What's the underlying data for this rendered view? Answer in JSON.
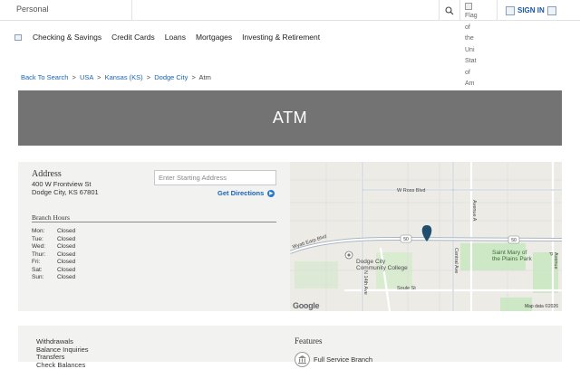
{
  "topbar": {
    "segment": "Personal",
    "flag_alt": "Flag of the United States of America",
    "flag_alt_visible": "Flag of the Uni Stat of Am",
    "signin_label": "SIGN IN"
  },
  "nav": {
    "items": [
      {
        "label": "Checking & Savings"
      },
      {
        "label": "Credit Cards"
      },
      {
        "label": "Loans"
      },
      {
        "label": "Mortgages"
      },
      {
        "label": "Investing & Retirement"
      }
    ]
  },
  "breadcrumb": {
    "back": "Back To Search",
    "country": "USA",
    "state": "Kansas (KS)",
    "city": "Dodge City",
    "current": "Atm",
    "separator": ">"
  },
  "banner": {
    "title": "ATM"
  },
  "location": {
    "address_title": "Address",
    "street": "400 W Frontview St",
    "city_line": "Dodge City, KS 67801",
    "start_placeholder": "Enter Starting Address",
    "directions_label": "Get Directions",
    "hours_title": "Branch Hours",
    "hours": [
      {
        "day": "Mon:",
        "status": "Closed"
      },
      {
        "day": "Tue:",
        "status": "Closed"
      },
      {
        "day": "Wed:",
        "status": "Closed"
      },
      {
        "day": "Thur:",
        "status": "Closed"
      },
      {
        "day": "Fri:",
        "status": "Closed"
      },
      {
        "day": "Sat:",
        "status": "Closed"
      },
      {
        "day": "Sun:",
        "status": "Closed"
      }
    ]
  },
  "map": {
    "labels": {
      "ross": "W Ross Blvd",
      "college": "Dodge City\nCommunity College",
      "saint_mary": "Saint Mary of\nthe Plains Park",
      "soule": "Soule St",
      "central": "Central Ave",
      "avenue_p": "Avenue P",
      "avenue_a": "Avenue A",
      "wyatt": "Wyatt Earp Blvd",
      "n14": "N 14th Ave",
      "route": "50"
    },
    "google": "Google",
    "credit": "Map data ©2026",
    "colors": {
      "marker": "#1f4e6e",
      "park": "#cde8c4",
      "water": "#aadaff"
    }
  },
  "services": {
    "items": [
      "Withdrawals",
      "Balance Inquiries",
      "Transfers",
      "Check Balances"
    ]
  },
  "features": {
    "title": "Features",
    "items": [
      {
        "label": "Full Service Branch",
        "icon": "bank-icon"
      }
    ]
  }
}
